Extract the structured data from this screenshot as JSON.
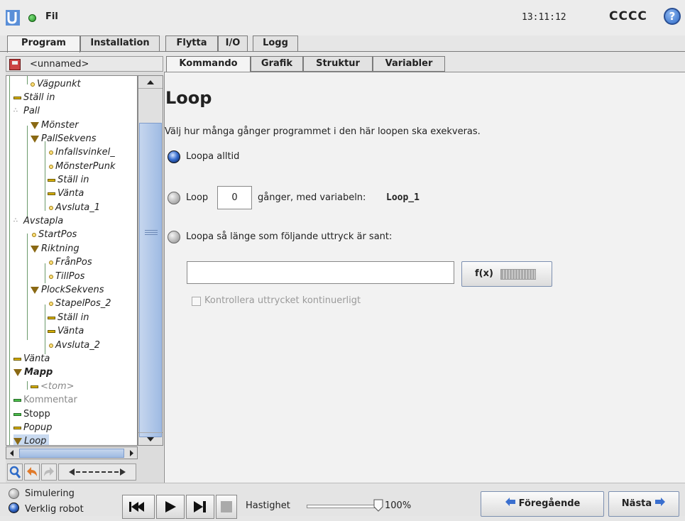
{
  "header": {
    "file_menu": "Fil",
    "clock": "13:11:12",
    "robot_name": "CCCC",
    "help": "?"
  },
  "main_tabs": [
    "Program",
    "Installation",
    "Flytta",
    "I/O",
    "Logg"
  ],
  "program_name": "<unnamed>",
  "tree": [
    {
      "label": "Vägpunkt",
      "icon": "waypoint-icon"
    },
    {
      "label": "Ställ in",
      "icon": "set-icon"
    },
    {
      "label": "Pall",
      "icon": "pallet-icon"
    },
    {
      "label": "Mönster",
      "icon": "folder-icon"
    },
    {
      "label": "PallSekvens",
      "icon": "folder-icon"
    },
    {
      "label": "Infallsvinkel_",
      "icon": "waypoint-icon"
    },
    {
      "label": "MönsterPunk",
      "icon": "waypoint-icon"
    },
    {
      "label": "Ställ in",
      "icon": "set-icon"
    },
    {
      "label": "Vänta",
      "icon": "wait-icon"
    },
    {
      "label": "Avsluta_1",
      "icon": "waypoint-icon"
    },
    {
      "label": "Avstapla",
      "icon": "pallet-icon"
    },
    {
      "label": "StartPos",
      "icon": "waypoint-icon"
    },
    {
      "label": "Riktning",
      "icon": "folder-icon"
    },
    {
      "label": "FrånPos",
      "icon": "waypoint-icon"
    },
    {
      "label": "TillPos",
      "icon": "waypoint-icon"
    },
    {
      "label": "PlockSekvens",
      "icon": "folder-icon"
    },
    {
      "label": "StapelPos_2",
      "icon": "waypoint-icon"
    },
    {
      "label": "Ställ in",
      "icon": "set-icon"
    },
    {
      "label": "Vänta",
      "icon": "wait-icon"
    },
    {
      "label": "Avsluta_2",
      "icon": "waypoint-icon"
    },
    {
      "label": "Vänta",
      "icon": "wait-icon"
    },
    {
      "label": "Mapp",
      "icon": "folder-icon"
    },
    {
      "label": "<tom>",
      "icon": "empty-icon"
    },
    {
      "label": "Kommentar",
      "icon": "comment-icon"
    },
    {
      "label": "Stopp",
      "icon": "stop-icon"
    },
    {
      "label": "Popup",
      "icon": "popup-icon"
    },
    {
      "label": "Loop",
      "icon": "loop-icon"
    }
  ],
  "sub_tabs": [
    "Kommando",
    "Grafik",
    "Struktur",
    "Variabler"
  ],
  "content": {
    "title": "Loop",
    "description": "Välj hur många gånger programmet i den här loopen ska exekveras.",
    "option_always": "Loopa alltid",
    "option_count_prefix": "Loop",
    "loop_count": "0",
    "option_count_suffix": "gånger, med variabeln:",
    "loop_variable": "Loop_1",
    "option_while": "Loopa så länge som följande uttryck är sant:",
    "expression_value": "",
    "fx_label": "f(x)",
    "check_label": "Kontrollera uttrycket kontinuerligt",
    "selected_option": "always"
  },
  "footer": {
    "simulation": "Simulering",
    "real_robot": "Verklig robot",
    "speed_label": "Hastighet",
    "speed_value": "100%",
    "speed_fraction": 1.0,
    "prev": "Föregående",
    "next": "Nästa"
  },
  "colors": {
    "accent_blue": "#3a6fcf",
    "selection": "#c9daf0",
    "status_green": "#1e8a1e"
  }
}
